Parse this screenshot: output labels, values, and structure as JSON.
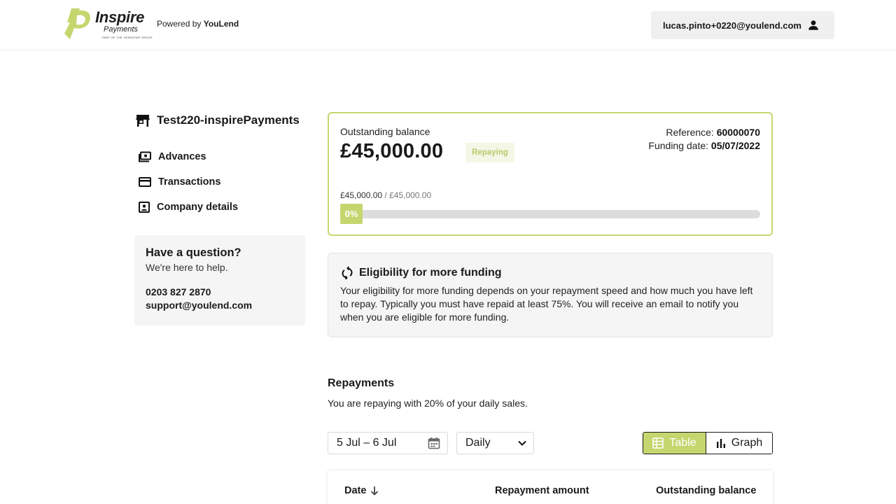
{
  "header": {
    "logo_word": "Inspire",
    "logo_sub": "Payments",
    "logo_tiny": "PART OF THE VERASTAR GROUP",
    "powered_prefix": "Powered by",
    "powered_brand": "YouLend",
    "user_email": "lucas.pinto+0220@youlend.com"
  },
  "sidebar": {
    "merchant_name": "Test220-inspirePayments",
    "items": [
      {
        "label": "Advances",
        "icon": "advances-icon"
      },
      {
        "label": "Transactions",
        "icon": "card-icon"
      },
      {
        "label": "Company details",
        "icon": "contact-card-icon"
      }
    ],
    "help": {
      "title": "Have a question?",
      "subtitle": "We're here to help.",
      "phone": "0203 827 2870",
      "email": "support@youlend.com"
    }
  },
  "balance": {
    "label": "Outstanding balance",
    "amount": "£45,000.00",
    "status": "Repaying",
    "reference_label": "Reference:",
    "reference_value": "60000070",
    "funding_label": "Funding date:",
    "funding_value": "05/07/2022",
    "progress_current": "£45,000.00",
    "progress_separator": "/",
    "progress_total": "£45,000.00",
    "progress_percent_label": "0%",
    "progress_fraction": 0
  },
  "eligibility": {
    "title": "Eligibility for more funding",
    "body": "Your eligibility for more funding depends on your repayment speed and how much you have left to repay. Typically you must have repaid at least 75%. You will receive an email to notify you when you are eligible for more funding."
  },
  "repayments": {
    "title": "Repayments",
    "subtitle": "You are repaying with 20% of your daily sales.",
    "date_range": "5 Jul – 6 Jul",
    "period": "Daily",
    "toggle_table": "Table",
    "toggle_graph": "Graph",
    "columns": [
      "Date",
      "Repayment amount",
      "Outstanding balance"
    ]
  },
  "colors": {
    "accent": "#c6d66f",
    "badge_bg": "#f4f7e6",
    "badge_text": "#b9c86a"
  }
}
